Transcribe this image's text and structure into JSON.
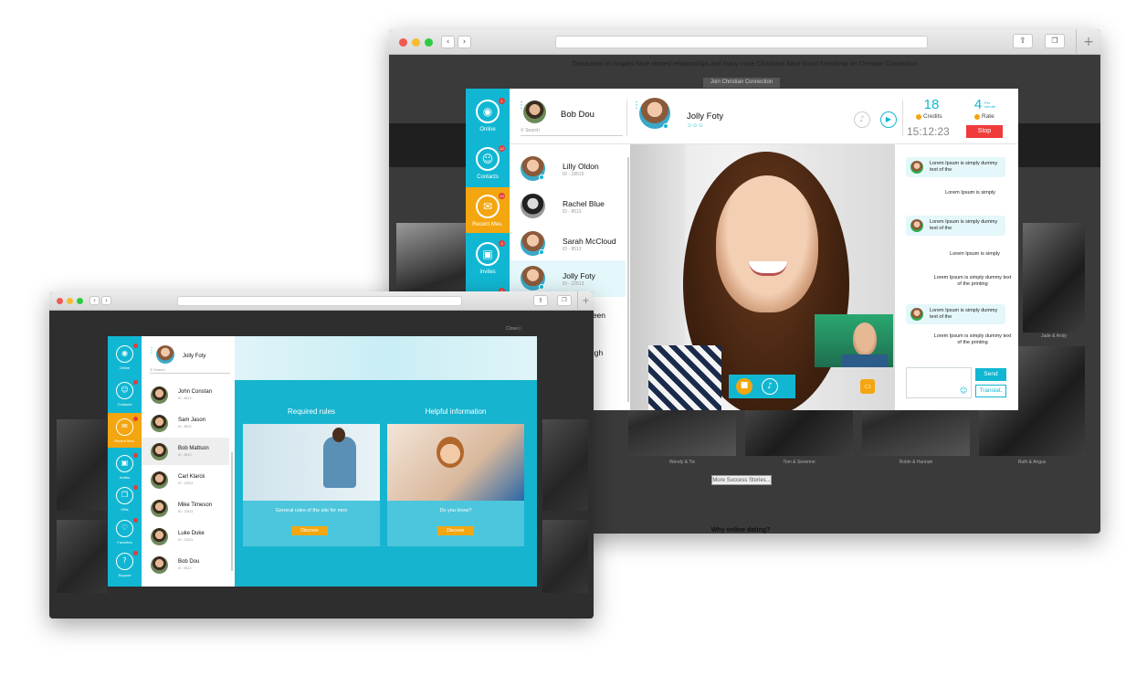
{
  "main_window": {
    "top_note": "Thousands of couples have started relationships and many more Christians have found friendship on Christian Connection",
    "join_button": "Join Christian Connection",
    "gallery_captions": [
      "Wendy & Tie",
      "Tom & Severine",
      "Robin & Hannah",
      "Ruth & Angus",
      "Jade & Andy"
    ],
    "more_stories": "More Success Stories...",
    "why_online": "Why online dating?",
    "rail": [
      {
        "label": "Online",
        "icon": "wifi-icon",
        "badge": "1"
      },
      {
        "label": "Contacts",
        "icon": "contacts-icon",
        "badge": "12"
      },
      {
        "label": "Recent Mes.",
        "icon": "messages-icon",
        "badge": "10",
        "active": true
      },
      {
        "label": "Invites",
        "icon": "invites-icon",
        "badge": "3"
      },
      {
        "label": "",
        "icon": "more-icon",
        "badge": "3"
      }
    ],
    "user": {
      "name": "Bob Dou",
      "search_placeholder": "Search"
    },
    "contacts": [
      {
        "name": "Lilly Oldon",
        "id": "ID - 18515"
      },
      {
        "name": "Rachel Blue",
        "id": "ID - 8513"
      },
      {
        "name": "Sarah McCloud",
        "id": "ID - 8513"
      },
      {
        "name": "Jolly Foty",
        "id": "ID - 22513",
        "selected": true
      },
      {
        "name": "reen",
        "id": ""
      },
      {
        "name": "ugh",
        "id": ""
      }
    ],
    "chat_partner": {
      "name": "Jolly Foty",
      "languages": "☺☺☺"
    },
    "stats": {
      "credits_value": "18",
      "credits_label": "Credits",
      "rate_value": "4",
      "rate_unit": "Per minute",
      "rate_label": "Rate",
      "timer": "15:12:23",
      "stop": "Stop"
    },
    "messages": [
      {
        "text": "Lorem Ipsum is simply dummy text of the",
        "incoming": true
      },
      {
        "text": "Lorem Ipsum is simply",
        "incoming": false
      },
      {
        "text": "Lorem Ipsum is simply dummy text of the",
        "incoming": true
      },
      {
        "text": "Lorem Ipsum is simply",
        "incoming": false
      },
      {
        "text": "Lorem Ipsum is simply dummy text of the printing",
        "incoming": false
      },
      {
        "text": "Lorem Ipsum is simply dummy text of the",
        "incoming": true
      },
      {
        "text": "Lorem Ipsum is simply dummy text of the printing",
        "incoming": false
      }
    ],
    "send": "Send",
    "translate": "Translat."
  },
  "second_window": {
    "close_label": "Closeⓧ",
    "user": {
      "name": "Jolly Foty",
      "search_placeholder": "Search"
    },
    "rail": [
      {
        "label": "Online"
      },
      {
        "label": "Contacts"
      },
      {
        "label": "Recent Mes.",
        "active": true
      },
      {
        "label": "Invites"
      },
      {
        "label": "Gifts"
      },
      {
        "label": "Favorites"
      },
      {
        "label": "Support"
      }
    ],
    "contacts": [
      {
        "name": "John Constan",
        "id": "ID - 8513"
      },
      {
        "name": "Sam Jason",
        "id": "ID - 8513"
      },
      {
        "name": "Bob Mattson",
        "id": "ID - 8513",
        "selected": true
      },
      {
        "name": "Carl Klarck",
        "id": "ID - 22513"
      },
      {
        "name": "Mike Timeson",
        "id": "ID - 22513"
      },
      {
        "name": "Luke Duke",
        "id": "ID - 22513"
      },
      {
        "name": "Bob Dou",
        "id": "ID - 8513"
      }
    ],
    "cards": [
      {
        "heading": "Required rules",
        "text": "General rules of the site for men",
        "button": "Discover"
      },
      {
        "heading": "Helpful information",
        "text": "Do you know?",
        "button": "Discover"
      }
    ]
  },
  "colors": {
    "accent": "#11b7d2",
    "active": "#f3a60f",
    "stop": "#ef3b3b"
  }
}
